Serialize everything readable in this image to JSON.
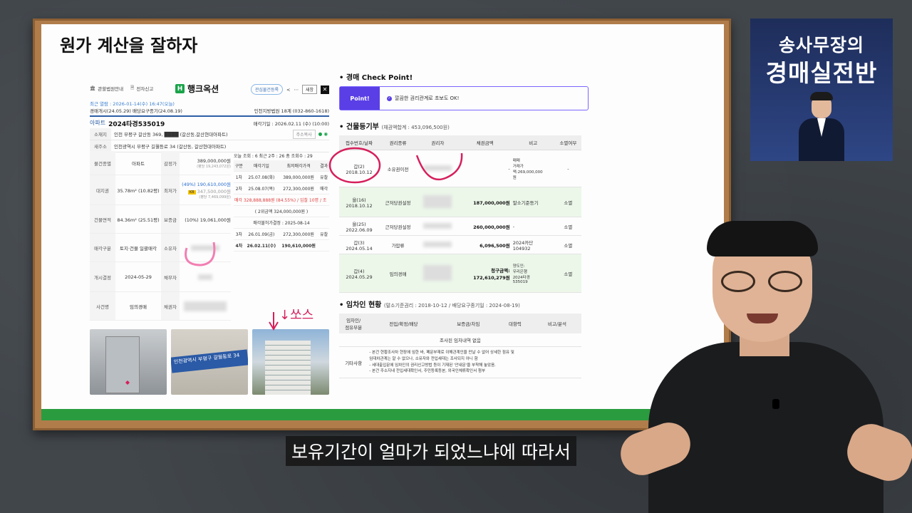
{
  "board": {
    "title": "원가 계산을 잘하자"
  },
  "auction": {
    "topbar": {
      "item1": "관할법원안내",
      "item2": "전자신고",
      "logo": "행크옥션",
      "logo_mark": "H",
      "interest": "관심물건등록",
      "print": "새창",
      "close": "✕"
    },
    "meta1": "최근 열람 : 2026-01-14(수) 16:47(오늘)",
    "meta2": "경매개시(24.05.29) 배당요구종기(24.08.19)",
    "meta_right": "인천지방법원 18계 (032-860-1618)",
    "case_type": "아파트",
    "case_no": "2024타경535019",
    "case_date": "매각기일 : 2026.02.11 (수) (10:00)",
    "location_label": "소재지",
    "location": "인천 부평구 갈산동 369, ████ (갈산동,갈산현대아파트)",
    "location_btn": "주소복사",
    "new_addr_label": "새주소",
    "new_addr": "인천광역시 부평구 길월등로 34 (갈산동, 갈산현대아파트)",
    "views": "오늘 조회 : 6   최근 2주 : 26   총 조회수 : 29",
    "fields": {
      "type_label": "물건종별",
      "type": "아파트",
      "appraisal_label": "감정가",
      "appraisal": "389,000,000원",
      "appraisal_sub": "(평당 19,243,072원)",
      "land_label": "대지권",
      "land": "35.78m² (10.82평)",
      "min_label": "최저가",
      "min": "(49%) 190,610,000원",
      "kb": "KB",
      "kb_val": "347,500,000원",
      "kb_sub": "(평당 7,469,099원)",
      "build_label": "건물면적",
      "build": "84.36m² (25.51평)",
      "deposit_label": "보증금",
      "deposit": "(10%) 19,061,000원",
      "sale_label": "매각구분",
      "sale": "토지·건물 일괄매각",
      "owner_label": "소유자",
      "start_label": "개시결정",
      "start": "2024-05-29",
      "debtor_label": "채무자",
      "case_label": "사건명",
      "case": "임의경매",
      "creditor_label": "채권자"
    },
    "rounds": {
      "headers": [
        "구분",
        "매각기일",
        "최저매각가격",
        "결과"
      ],
      "rows": [
        [
          "1차",
          "25.07.08(화)",
          "389,000,000원",
          "유찰"
        ],
        [
          "2차",
          "25.08.07(목)",
          "272,300,000원",
          "매각"
        ]
      ],
      "sold": "매각 328,888,888원 (84.55%) / 입찰 10명 / 조",
      "second": "( 2위금액 324,000,000원 )",
      "fail": "매각불허가결정 : 2025-08-14",
      "rows2": [
        [
          "3차",
          "26.01.09(금)",
          "272,300,000원",
          "유찰"
        ],
        [
          "4차",
          "26.02.11(수)",
          "190,610,000원",
          ""
        ]
      ]
    },
    "photo_sign": "인천광역시 부평구 갈월동로 34"
  },
  "right": {
    "check_title": "경매 Check Point!",
    "point_tag": "Point!",
    "point_text": "깔끔한 권리관계로 초보도 OK!",
    "reg_title": "건물등기부",
    "reg_sub": "(채권액합계 : 453,096,500원)",
    "reg_headers": [
      "접수번호/날짜",
      "권리종류",
      "권리자",
      "채권금액",
      "비고",
      "소멸여부"
    ],
    "reg_rows": [
      {
        "no": "갑(2)",
        "date": "2018.10.12",
        "kind": "소유권이전",
        "amount": "-",
        "note": "매매\n거래가\n액:269,000,000\n원",
        "status": "-"
      },
      {
        "no": "을(16)",
        "date": "2018.10.12",
        "kind": "근저당권설정",
        "amount": "187,000,000원",
        "note": "말소기준등기",
        "status": "소멸"
      },
      {
        "no": "을(25)",
        "date": "2022.06.09",
        "kind": "근저당권설정",
        "amount": "260,000,000원",
        "note": "-",
        "status": "소멸"
      },
      {
        "no": "갑(3)",
        "date": "2024.05.14",
        "kind": "가압류",
        "amount": "6,096,500원",
        "note": "2024카단\n104932",
        "status": "소멸"
      },
      {
        "no": "갑(4)",
        "date": "2024.05.29",
        "kind": "임의경매",
        "amount": "청구금액:\n172,610,279원",
        "note": "양도인:\n우리은행\n2024타경\n535019",
        "status": "소멸"
      }
    ],
    "ten_title": "임차인 현황",
    "ten_sub": "(말소기준권리 : 2018-10-12 / 배당요구종기일 : 2024-08-19)",
    "ten_headers": [
      "임차인/\n점유부분",
      "전입/확정/배당",
      "보증금/차임",
      "대항력",
      "비고/분석"
    ],
    "ten_empty": "조사된 임차내역 없음",
    "other_label": "기타사항",
    "other_lines": [
      "- 본건 현황조사차 현장에 임한 바, 폐문부재로 이해관계인을 만날 수 없어 상세한 점유 및",
      "  임대차관계는 알 수 없으나, 소유자와 전입세대는 조사되지 아니 함",
      "- 세대출입문에 임차인의 권리신고방법 등이 기재된 '안내문'을 부착해 놓았음.",
      "- 본건 주소지내 전입세대확인서, 주민등록등본, 외국인체류확인서 첨부"
    ]
  },
  "thumbnail": {
    "line1": "송사무장의",
    "line2": "경매실전반"
  },
  "subtitle": "보유기간이 얼마가 되었느냐에 따라서",
  "annotation": {
    "handwriting": "↓쏘스"
  }
}
